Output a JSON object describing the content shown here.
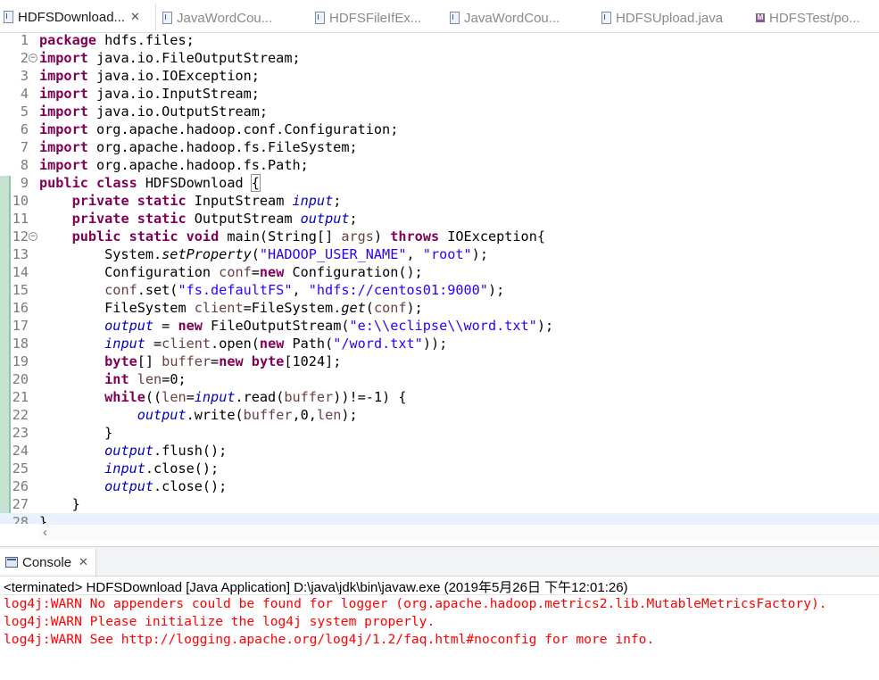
{
  "editor_tabs": [
    {
      "label": "HDFSDownload...",
      "active": true,
      "icon": "java-file-icon",
      "closable": true
    },
    {
      "label": "JavaWordCou...",
      "active": false,
      "icon": "java-file-icon"
    },
    {
      "label": "HDFSFileIfEx...",
      "active": false,
      "icon": "java-file-icon"
    },
    {
      "label": "JavaWordCou...",
      "active": false,
      "icon": "java-file-icon"
    },
    {
      "label": "HDFSUpload.java",
      "active": false,
      "icon": "java-file-icon"
    },
    {
      "label": "HDFSTest/po...",
      "active": false,
      "icon": "maven-pom-icon"
    }
  ],
  "code": {
    "line_numbers": [
      "1",
      "2",
      "3",
      "4",
      "5",
      "6",
      "7",
      "8",
      "9",
      "10",
      "11",
      "12",
      "13",
      "14",
      "15",
      "16",
      "17",
      "18",
      "19",
      "20",
      "21",
      "22",
      "23",
      "24",
      "25",
      "26",
      "27",
      "28"
    ],
    "lines": [
      "package hdfs.files;",
      "import java.io.FileOutputStream;",
      "import java.io.IOException;",
      "import java.io.InputStream;",
      "import java.io.OutputStream;",
      "import org.apache.hadoop.conf.Configuration;",
      "import org.apache.hadoop.fs.FileSystem;",
      "import org.apache.hadoop.fs.Path;",
      "public class HDFSDownload {",
      "    private static InputStream input;",
      "    private static OutputStream output;",
      "    public static void main(String[] args) throws IOException{",
      "        System.setProperty(\"HADOOP_USER_NAME\", \"root\");",
      "        Configuration conf=new Configuration();",
      "        conf.set(\"fs.defaultFS\", \"hdfs://centos01:9000\");",
      "        FileSystem client=FileSystem.get(conf);",
      "        output = new FileOutputStream(\"e:\\\\eclipse\\\\word.txt\");",
      "        input =client.open(new Path(\"/word.txt\"));",
      "        byte[] buffer=new byte[1024];",
      "        int len=0;",
      "        while((len=input.read(buffer))!=-1) {",
      "            output.write(buffer,0,len);",
      "        }",
      "        output.flush();",
      "        input.close();",
      "        output.close();",
      "    }",
      "}"
    ],
    "fold_markers": [
      2,
      12
    ],
    "highlighted_line": 28
  },
  "console": {
    "tab_label": "Console",
    "status": "<terminated> HDFSDownload [Java Application] D:\\java\\jdk\\bin\\javaw.exe (2019年5月26日 下午12:01:26)",
    "output": [
      "log4j:WARN No appenders could be found for logger (org.apache.hadoop.metrics2.lib.MutableMetricsFactory).",
      "log4j:WARN Please initialize the log4j system properly.",
      "log4j:WARN See http://logging.apache.org/log4j/1.2/faq.html#noconfig for more info."
    ],
    "output_color": "#ff0000"
  },
  "colors": {
    "keyword": "#7f0055",
    "string": "#2a00ff",
    "field": "#0000c0",
    "local_var": "#6a3e3e",
    "change_ruler": "#c6e3d2"
  }
}
